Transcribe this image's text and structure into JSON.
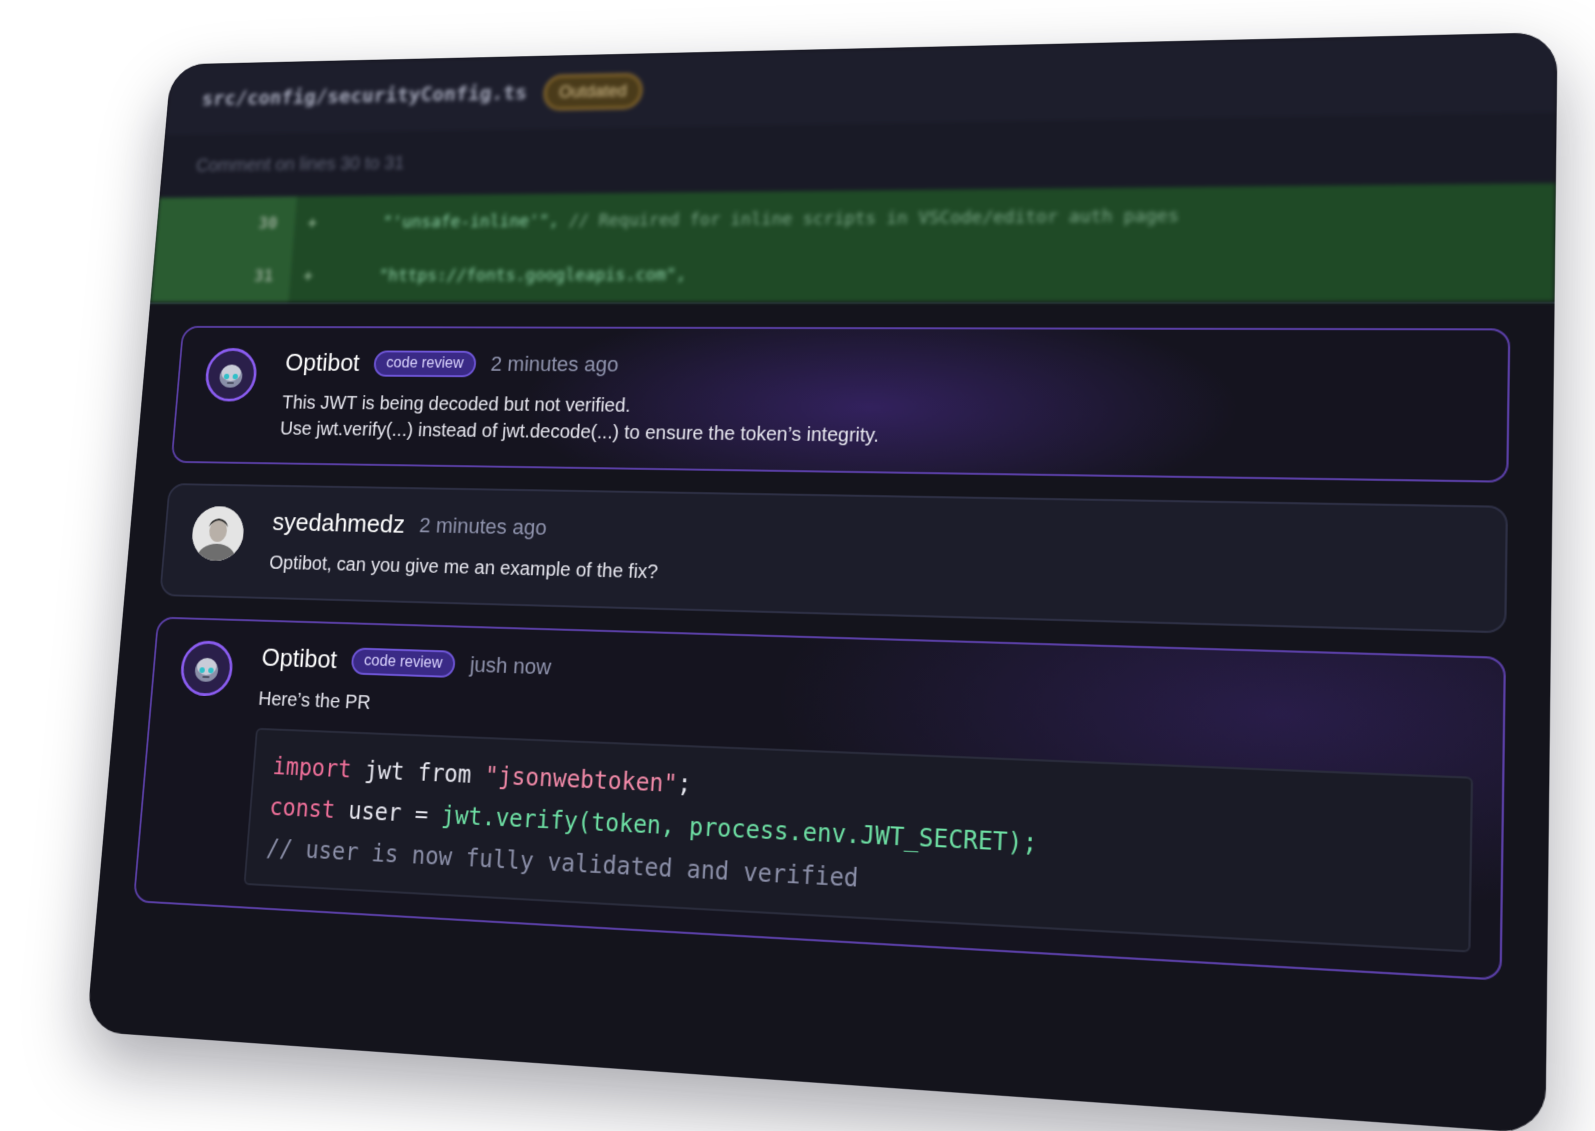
{
  "file": {
    "path": "src/config/securityConfig.ts",
    "status_badge": "Outdated",
    "comment_range": "Comment on lines 30 to 31"
  },
  "diff_lines": [
    {
      "number": "30",
      "marker": "+",
      "code": "\"'unsafe-inline'\",",
      "comment": "// Required for inline scripts in VSCode/editor auth pages"
    },
    {
      "number": "31",
      "marker": "+",
      "code": "\"https://fonts.googleapis.com\",",
      "comment": ""
    }
  ],
  "comments": [
    {
      "author": "Optibot",
      "badge": "code review",
      "time": "2 minutes ago",
      "lines": [
        "This JWT is being decoded but not verified.",
        "Use jwt.verify(...) instead of jwt.decode(...) to ensure the token’s integrity."
      ]
    },
    {
      "author": "syedahmedz",
      "time": "2 minutes ago",
      "lines": [
        "Optibot, can you give me an example of the fix?"
      ]
    },
    {
      "author": "Optibot",
      "badge": "code review",
      "time": "jush now",
      "lines": [
        "Here’s the PR"
      ],
      "code": {
        "line1": {
          "kw": "import",
          "mid": " jwt from ",
          "str": "\"jsonwebtoken\"",
          "end": ";"
        },
        "line2": {
          "kw": "const",
          "mid": " user = ",
          "fn": "jwt.verify(token, process.env.JWT_SECRET);"
        },
        "line3": {
          "comment": "// user is now fully validated and verified"
        }
      }
    }
  ],
  "colors": {
    "card_bg": "#14141c",
    "accent_purple": "#6f56d8",
    "diff_green": "#1f4a26",
    "keyword_pink": "#f0709a",
    "function_green": "#6ee0a4"
  }
}
